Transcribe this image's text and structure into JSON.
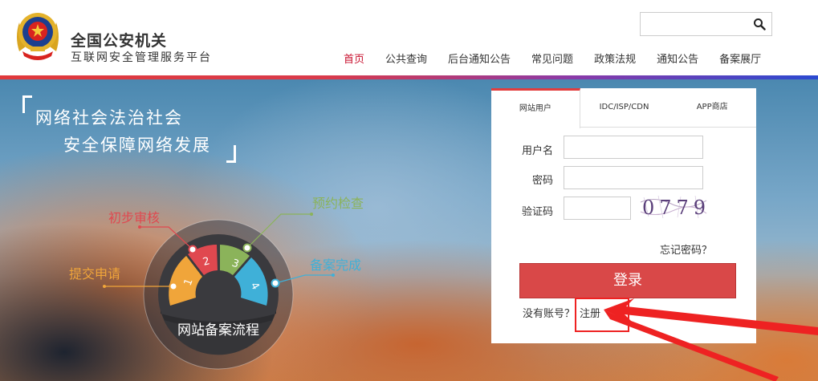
{
  "header": {
    "title": "全国公安机关",
    "subtitle": "互联网安全管理服务平台",
    "search": {
      "value": "",
      "placeholder": ""
    },
    "nav": [
      "首页",
      "公共查询",
      "后台通知公告",
      "常见问题",
      "政策法规",
      "通知公告",
      "备案展厅"
    ],
    "active_nav_index": 0,
    "colors": {
      "accent": "#c8102e",
      "header_line_start": "#e0393b",
      "header_line_end": "#2b4ad1"
    }
  },
  "hero": {
    "slogan_line1": "网络社会法治社会",
    "slogan_line2": "安全保障网络发展",
    "flow_title": "网站备案流程",
    "steps": [
      {
        "number": "1",
        "label": "提交申请",
        "color": "#f0a53a"
      },
      {
        "number": "2",
        "label": "初步审核",
        "color": "#e0484f"
      },
      {
        "number": "3",
        "label": "预约检查",
        "color": "#8bb35a"
      },
      {
        "number": "4",
        "label": "备案完成",
        "color": "#3fb0d8"
      }
    ]
  },
  "login": {
    "tabs": [
      "网站用户",
      "IDC/ISP/CDN",
      "APP商店"
    ],
    "active_tab_index": 0,
    "username_label": "用户名",
    "password_label": "密码",
    "captcha_label": "验证码",
    "captcha_text": "0779",
    "forgot_label": "忘记密码？",
    "login_button": "登录",
    "no_account_label": "没有账号？",
    "register_label": "注册",
    "colors": {
      "button": "#d94848",
      "tab_accent": "#e23d3d"
    }
  },
  "annotation": {
    "color": "#ee2222"
  }
}
